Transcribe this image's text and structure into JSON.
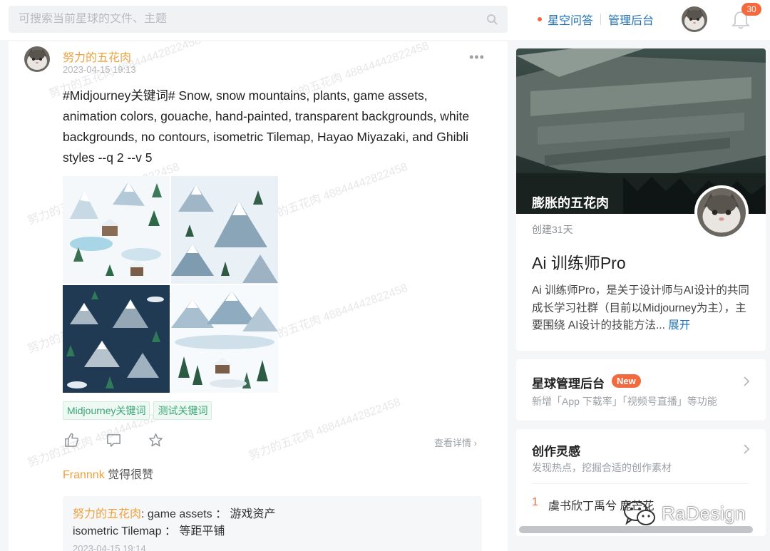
{
  "header": {
    "search_placeholder": "可搜索当前星球的文件、主题",
    "links": [
      "星空问答",
      "管理后台"
    ],
    "notification_count": "30"
  },
  "post": {
    "author": "努力的五花肉",
    "time": "2023-04-15 19:13",
    "text": "#Midjourney关键词# Snow, snow mountains, plants, game assets, animation colors, gouache, hand-painted, transparent backgrounds, white backgrounds, no contours, isometric Tilemap, Hayao Miyazaki, and Ghibli styles --q 2 --v 5",
    "tags": [
      "Midjourney关键词",
      "测试关键词"
    ],
    "detail_link": "查看详情",
    "like_user": "Frannnk",
    "like_text": " 觉得很赞",
    "comment": {
      "author": "努力的五花肉",
      "line1": ": game assets ： 游戏资产",
      "line2": "isometric Tilemap ： 等距平铺",
      "time": "2023-04-15 19:14"
    }
  },
  "watermark": {
    "text": "努力的五花肉 48844442822458"
  },
  "group": {
    "owner": "膨胀的五花肉",
    "created": "创建31天",
    "title": "Ai 训练师Pro",
    "description": "Ai 训练师Pro，是关于设计师与AI设计的共同成长学习社群（目前以Midjourney为主），主要围绕 AI设计的技能方法...",
    "expand": "展开"
  },
  "admin": {
    "title": "星球管理后台",
    "badge": "New",
    "subtitle": "新增「App 下载率」「视频号直播」等功能"
  },
  "ideas": {
    "title": "创作灵感",
    "subtitle": "发现热点，挖掘合适的创作素材",
    "rank": "1",
    "first_item": "虞书欣丁禹兮 鹿芒花"
  },
  "brand": {
    "text": "RaDesign"
  },
  "colors": {
    "accent_orange": "#f26a3d",
    "author_orange": "#f0a03c",
    "link_blue": "#1f6fb5",
    "tag_green": "#3aa57a"
  }
}
